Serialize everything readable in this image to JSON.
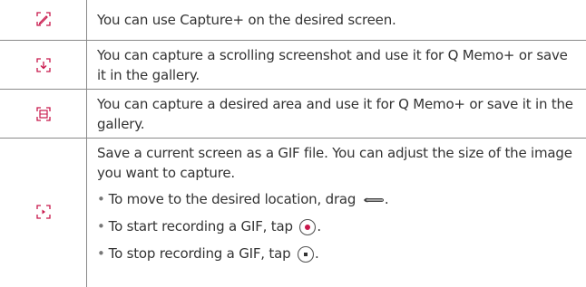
{
  "rows": [
    {
      "icon": "pen-icon",
      "text": "You can use Capture+ on the desired screen."
    },
    {
      "icon": "scroll-capture-icon",
      "text": "You can capture a scrolling screenshot and use it for Q Memo+ or save it in the gallery."
    },
    {
      "icon": "area-capture-icon",
      "text": "You can capture a desired area and use it for Q Memo+ or save it in the gallery."
    },
    {
      "icon": "gif-capture-icon",
      "text": "Save a current screen as a GIF file. You can adjust the size of the image you want to capture.",
      "bullets": [
        {
          "bullet": "•",
          "text": "To move to the desired location, drag",
          "icon": "drag-handle-icon",
          "suffix": "."
        },
        {
          "bullet": "•",
          "text": "To start recording a GIF, tap",
          "icon": "record-icon",
          "suffix": "."
        },
        {
          "bullet": "•",
          "text": "To stop recording a GIF, tap",
          "icon": "stop-icon",
          "suffix": "."
        }
      ]
    }
  ],
  "colors": {
    "icon_accent": "#c8174b",
    "border": "#8a8a8a",
    "text": "#333333"
  }
}
